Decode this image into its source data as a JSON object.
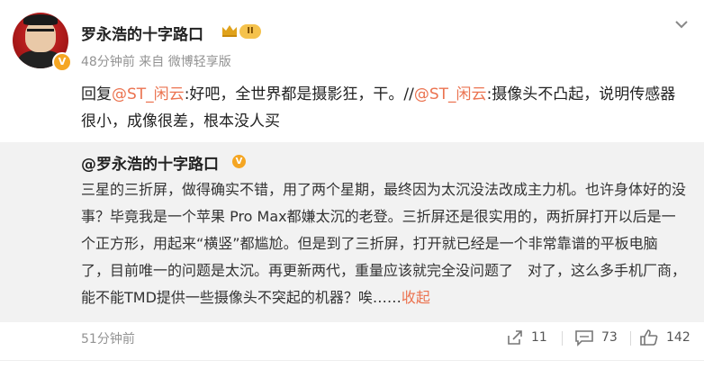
{
  "post": {
    "author": "罗永浩的十字路口",
    "level_badge": "II",
    "verified_badge": "V",
    "meta": "48分钟前 来自 微博轻享版",
    "reply_prefix": "回复",
    "reply_mention1": "@ST_闲云",
    "reply_text1": ":好吧，全世界都是摄影狂，干。//",
    "reply_mention2": "@ST_闲云",
    "reply_text2": ":摄像头不凸起，说明传感器很小，成像很差，根本没人买"
  },
  "quoted": {
    "author": "@罗永浩的十字路口",
    "verified_badge": "V",
    "text": "三星的三折屏，做得确实不错，用了两个星期，最终因为太沉没法改成主力机。也许身体好的没事？毕竟我是一个苹果 Pro Max都嫌太沉的老登。三折屏还是很实用的，两折屏打开以后是一个正方形，用起来“横竖”都尴尬。但是到了三折屏，打开就已经是一个非常靠谱的平板电脑了，目前唯一的问题是太沉。再更新两代，重量应该就完全没问题了　对了，这么多手机厂商，能不能TMD提供一些摄像头不突起的机器？唉……",
    "collapse_label": "收起",
    "time": "51分钟前",
    "actions": {
      "repost_count": "11",
      "comment_count": "73",
      "like_count": "142"
    }
  },
  "icons": {
    "more": "chevron-down-icon",
    "crown": "crown-icon",
    "repost": "repost-icon",
    "comment": "comment-icon",
    "like": "thumbs-up-icon"
  },
  "colors": {
    "mention": "#eb7350",
    "verified": "#f5a623",
    "quote_bg": "#f2f2f2"
  }
}
